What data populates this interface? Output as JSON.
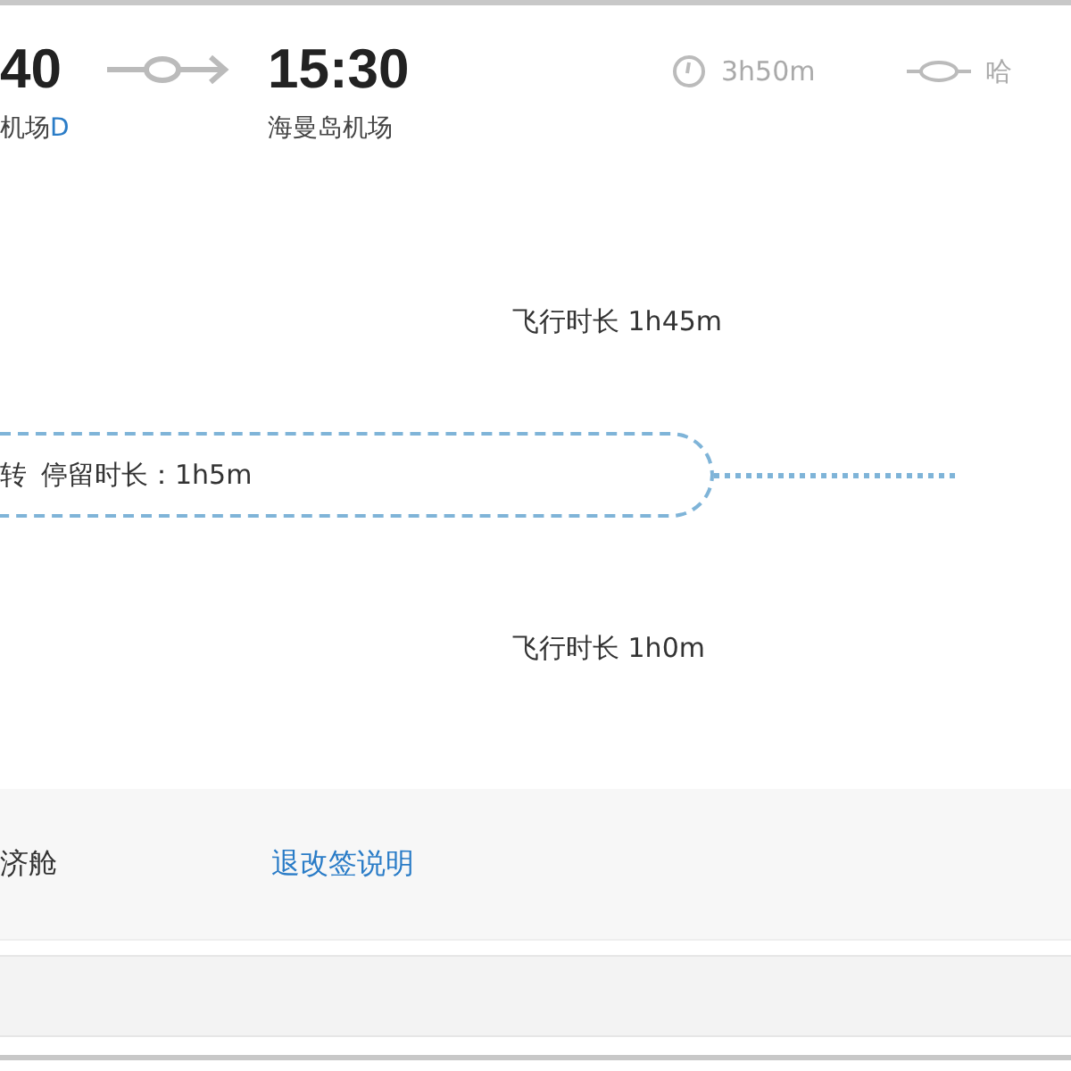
{
  "depart": {
    "time": "40",
    "airport": "机场",
    "terminal": "D"
  },
  "arrive": {
    "time": "15:30",
    "airport": "海曼岛机场"
  },
  "duration": "3h50m",
  "stop": "哈",
  "legs": [
    {
      "flight_duration": "飞行时长 1h45m"
    },
    {
      "flight_duration": "飞行时长 1h0m"
    }
  ],
  "transfer": {
    "label": "转",
    "layover": "停留时长：1h5m"
  },
  "cabin": "济舱",
  "rules_link": "退改签说明"
}
